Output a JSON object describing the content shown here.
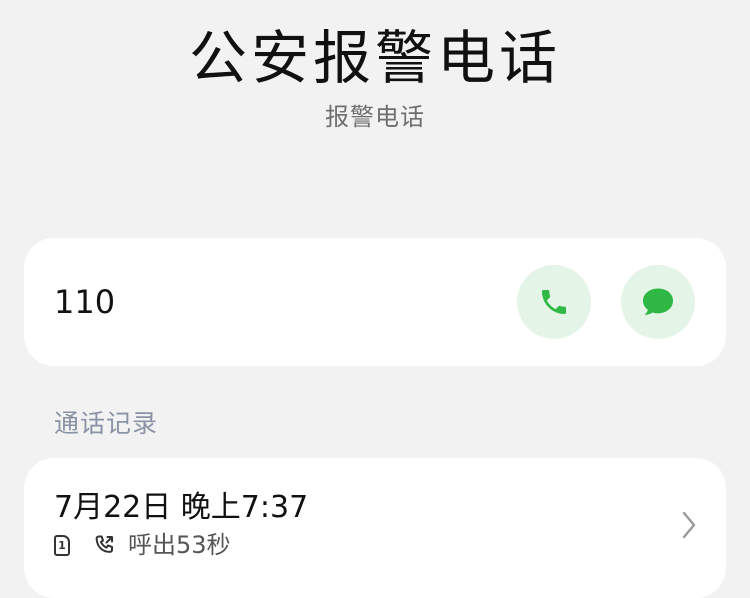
{
  "header": {
    "title": "公安报警电话",
    "subtitle": "报警电话"
  },
  "contact": {
    "number": "110",
    "actions": [
      {
        "name": "call",
        "icon": "phone-icon"
      },
      {
        "name": "message",
        "icon": "message-bubble-icon"
      }
    ],
    "accent_color": "#2fb944",
    "action_bg_color": "#e4f4e6"
  },
  "call_log": {
    "section_label": "通话记录",
    "entries": [
      {
        "datetime": "7月22日 晚上7:37",
        "sim": "1",
        "type_text": "呼出53秒",
        "icons": [
          "sim-1-icon",
          "outgoing-call-icon",
          "chevron-right-icon"
        ]
      }
    ]
  }
}
